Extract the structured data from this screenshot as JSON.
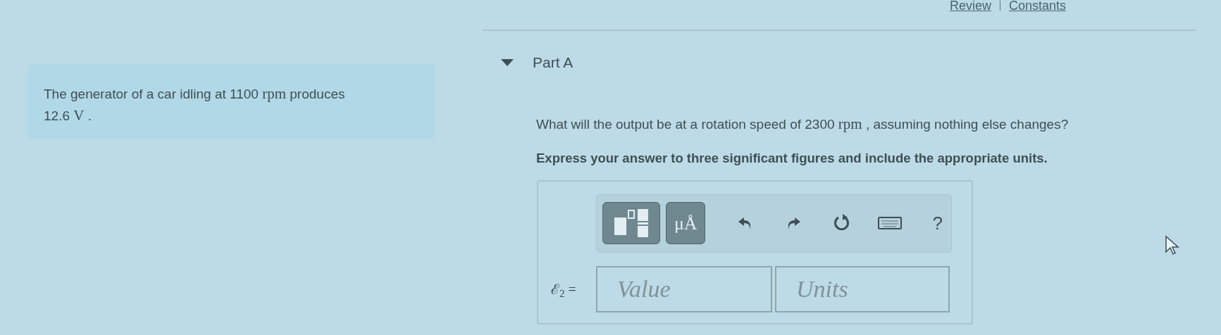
{
  "header_links": [
    "Review",
    "Constants"
  ],
  "problem": [
    {
      "kind": "text",
      "text": "The generator of a car idling at 1100 "
    },
    {
      "kind": "unit",
      "text": "rpm"
    },
    {
      "kind": "text",
      "text": " produces 12.6 "
    },
    {
      "kind": "unit",
      "text": "V"
    },
    {
      "kind": "text",
      "text": " ."
    }
  ],
  "part": {
    "title": "Part A",
    "expanded": true
  },
  "question": [
    {
      "kind": "text",
      "text": "What will the output be at a rotation speed of 2300 "
    },
    {
      "kind": "unit",
      "text": "rpm"
    },
    {
      "kind": "text",
      "text": " , assuming nothing else changes?"
    }
  ],
  "instruction": "Express your answer to three significant figures and include the appropriate units.",
  "toolbar": [
    {
      "kind": "templates"
    },
    {
      "kind": "units",
      "label": "μÅ"
    },
    {
      "kind": "undo"
    },
    {
      "kind": "redo"
    },
    {
      "kind": "reset"
    },
    {
      "kind": "keyboard"
    },
    {
      "kind": "help",
      "label": "?"
    }
  ],
  "answer": {
    "label": "ℰ$_{2}$ =",
    "value_placeholder": "Value",
    "units_placeholder": "Units"
  }
}
